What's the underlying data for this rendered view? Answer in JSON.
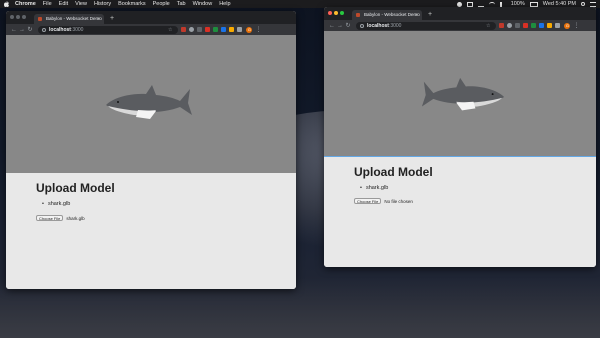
{
  "menubar": {
    "app": "Chrome",
    "items": [
      "File",
      "Edit",
      "View",
      "History",
      "Bookmarks",
      "People",
      "Tab",
      "Window",
      "Help"
    ],
    "battery": "100%",
    "clock": "Wed 5:40 PM"
  },
  "windows": [
    {
      "tab_title": "Babylon - Websocket Demo",
      "url_host": "localhost",
      "url_port": ":3000",
      "heading": "Upload Model",
      "files": [
        "shark.glb"
      ],
      "choose_label": "Choose File",
      "file_status": "shark.glb"
    },
    {
      "tab_title": "Babylon - Websocket Demo",
      "url_host": "localhost",
      "url_port": ":3000",
      "heading": "Upload Model",
      "files": [
        "shark.glb"
      ],
      "choose_label": "Choose File",
      "file_status": "No file chosen"
    }
  ],
  "colors": {
    "viewport": "#888888",
    "page_bg": "#e8e8e8",
    "chrome_dark": "#202124",
    "focus_line": "#64a8e6"
  }
}
